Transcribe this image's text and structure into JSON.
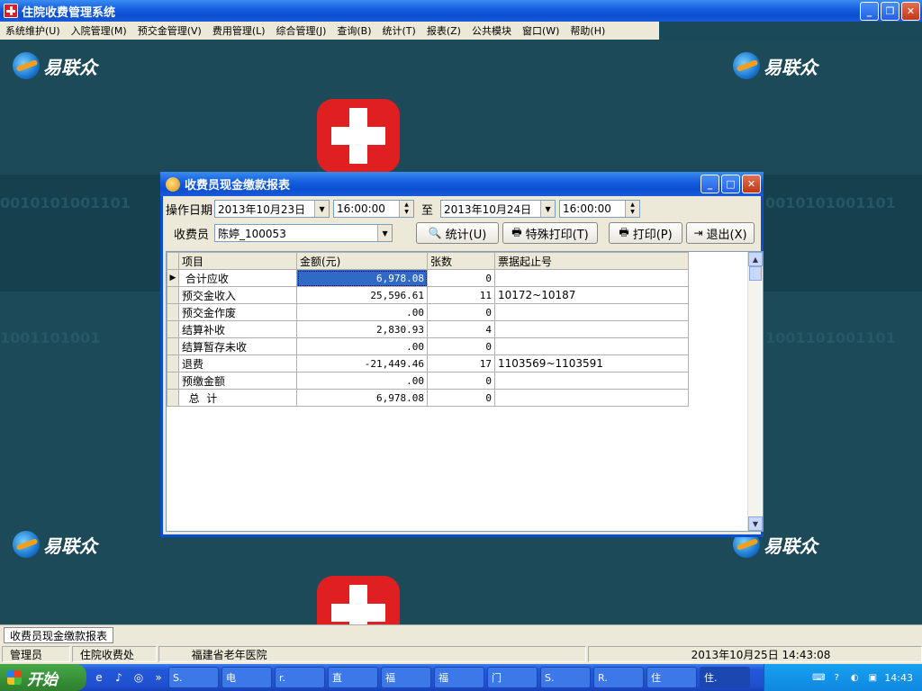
{
  "app": {
    "title": "住院收费管理系统",
    "brand": "易联众"
  },
  "menu": [
    "系统维护(U)",
    "入院管理(M)",
    "预交金管理(V)",
    "费用管理(L)",
    "综合管理(J)",
    "查询(B)",
    "统计(T)",
    "报表(Z)",
    "公共模块",
    "窗口(W)",
    "帮助(H)"
  ],
  "dialog": {
    "title": "收费员现金缴款报表",
    "op_date_label": "操作日期",
    "date_from": "2013年10月23日",
    "time_from": "16:00:00",
    "to_label": "至",
    "date_to": "2013年10月24日",
    "time_to": "16:00:00",
    "cashier_label": "收费员",
    "cashier_value": "陈婷_100053",
    "btn_stat": "统计(U)",
    "btn_special_print": "特殊打印(T)",
    "btn_print": "打印(P)",
    "btn_exit": "退出(X)"
  },
  "grid": {
    "headers": [
      "项目",
      "金额(元)",
      "张数",
      "票据起止号"
    ],
    "rows": [
      {
        "item": " 合计应收",
        "amount": "6,978.08",
        "count": "0",
        "tickets": ""
      },
      {
        "item": "预交金收入",
        "amount": "25,596.61",
        "count": "11",
        "tickets": "10172~10187"
      },
      {
        "item": "预交金作废",
        "amount": ".00",
        "count": "0",
        "tickets": ""
      },
      {
        "item": "结算补收",
        "amount": "2,830.93",
        "count": "4",
        "tickets": ""
      },
      {
        "item": "结算暂存未收",
        "amount": ".00",
        "count": "0",
        "tickets": ""
      },
      {
        "item": "退费",
        "amount": "-21,449.46",
        "count": "17",
        "tickets": "1103569~1103591"
      },
      {
        "item": "预缴金额",
        "amount": ".00",
        "count": "0",
        "tickets": ""
      },
      {
        "item": "  总  计",
        "amount": "6,978.08",
        "count": "0",
        "tickets": ""
      }
    ]
  },
  "mdi_tab": "收费员现金缴款报表",
  "status": {
    "user": "管理员",
    "dept": "住院收费处",
    "hospital": "福建省老年医院",
    "datetime": "2013年10月25日 14:43:08"
  },
  "taskbar": {
    "start": "开始",
    "buttons": [
      "S.",
      "电",
      "r.",
      "直",
      "福",
      "福",
      "门",
      "S.",
      "R.",
      "住",
      "住."
    ],
    "clock": "14:43"
  },
  "colors": {
    "titlebar": "#0a4fd0",
    "desktop": "#1c4a58",
    "selection": "#316ac5",
    "redcross": "#e02020"
  }
}
